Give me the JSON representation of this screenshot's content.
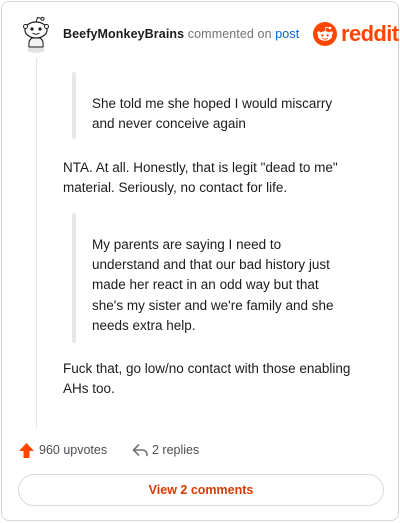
{
  "header": {
    "username": "BeefyMonkeyBrains",
    "commented_text": "commented on",
    "post_link": "post",
    "brand": "reddit"
  },
  "comment": {
    "quote1": [
      "She told me she hoped I would miscarry",
      "and never conceive again"
    ],
    "para1": [
      "NTA. At all. Honestly, that is legit \"dead to me\"",
      "material. Seriously, no contact for life."
    ],
    "quote2": [
      "My parents are saying I need to",
      "understand and that our bad history just",
      "made her react in an odd way but that",
      "she's my sister and we're family and she",
      "needs extra help."
    ],
    "para2": [
      "Fuck that, go low/no contact with those enabling",
      "AHs too."
    ]
  },
  "footer": {
    "upvotes": "960 upvotes",
    "replies": "2 replies",
    "view_comments": "View 2 comments"
  },
  "icons": {
    "avatar": "snoo-avatar-icon",
    "logo": "reddit-logo-icon",
    "upvote": "upvote-arrow-icon",
    "reply": "reply-arrow-icon"
  },
  "colors": {
    "brand": "#ff4500",
    "link": "#0a5fd1",
    "button_text": "#d93a00",
    "quote_bar": "#e6e7e8",
    "muted": "#6f7377"
  }
}
